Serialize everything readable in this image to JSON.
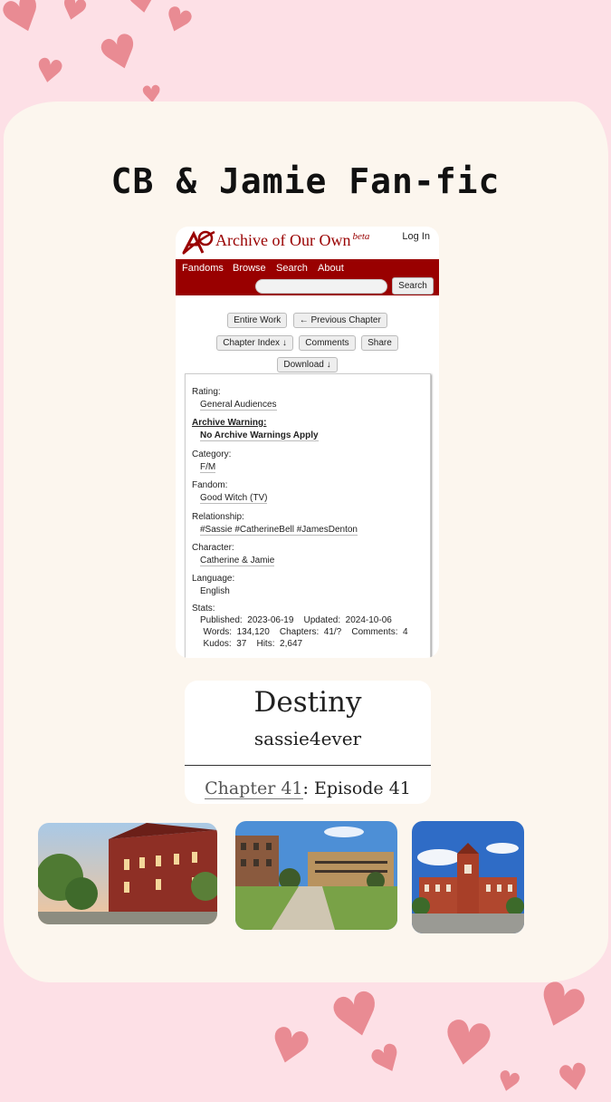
{
  "title": "CB & Jamie Fan-fic",
  "ao3": {
    "site_name": "Archive of Our Own",
    "beta": "beta",
    "login": "Log In",
    "nav": [
      "Fandoms",
      "Browse",
      "Search",
      "About"
    ],
    "search_button": "Search",
    "buttons": {
      "entire_work": "Entire Work",
      "previous_chapter": "← Previous Chapter",
      "chapter_index": "Chapter Index ↓",
      "comments": "Comments",
      "share": "Share",
      "download": "Download ↓"
    },
    "meta": {
      "rating_label": "Rating:",
      "rating": "General Audiences",
      "warning_label": "Archive Warning:",
      "warning": "No Archive Warnings Apply",
      "category_label": "Category:",
      "category": "F/M",
      "fandom_label": "Fandom:",
      "fandom": "Good Witch (TV)",
      "relationship_label": "Relationship:",
      "relationship": "#Sassie #CatherineBell #JamesDenton",
      "character_label": "Character:",
      "character": "Catherine & Jamie",
      "language_label": "Language:",
      "language": "English",
      "stats_label": "Stats:",
      "stats_line1": "Published:  2023-06-19    Updated:  2024-10-06",
      "stats_line2": "  Words:  134,120    Chapters:  41/?    Comments:  4",
      "stats_line3": "  Kudos:  37    Hits:  2,647"
    }
  },
  "work": {
    "title": "Destiny",
    "author": "sassie4ever",
    "chapter_link": "Chapter 41",
    "chapter_title": ": Episode 41"
  },
  "colors": {
    "background": "#fde0e6",
    "hearts": "#e98b93",
    "card": "#fcf6ee",
    "ao3_red": "#990000"
  },
  "photos": [
    "campus-photo-red-brick-hall",
    "campus-photo-courtyard",
    "campus-photo-tower-building"
  ]
}
